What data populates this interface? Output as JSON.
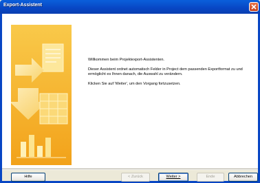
{
  "window": {
    "title": "Export-Assistent"
  },
  "content": {
    "paragraphs": [
      "Willkommen beim Projektexport-Assistenten.",
      "Dieser Assistent ordnet automatisch Felder in Project dem passenden Exportformat zu und ermöglicht es Ihnen danach, die Auswahl zu verändern.",
      "Klicken Sie auf 'Weiter', um den Vorgang fortzusetzen."
    ]
  },
  "buttons": {
    "help": {
      "label": "Hilfe",
      "enabled": true
    },
    "back": {
      "label": "< Zurück",
      "enabled": false
    },
    "next": {
      "label": "Weiter >",
      "enabled": true,
      "default": true
    },
    "finish": {
      "label": "Ende",
      "enabled": false
    },
    "cancel": {
      "label": "Abbrechen",
      "enabled": true
    }
  },
  "colors": {
    "titlebar": "#0846c4",
    "banner": "#f6b629",
    "close": "#c3411c"
  }
}
